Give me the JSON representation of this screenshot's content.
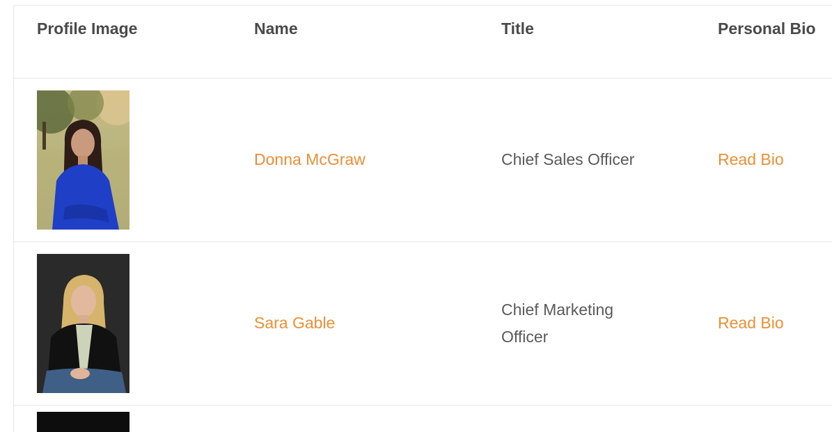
{
  "table": {
    "headers": {
      "profile_image": "Profile Image",
      "name": "Name",
      "title": "Title",
      "bio": "Personal Bio"
    },
    "rows": [
      {
        "name": "Donna McGraw",
        "title": "Chief Sales Officer",
        "bio_link": "Read Bio"
      },
      {
        "name": "Sara Gable",
        "title": "Chief Marketing Officer",
        "bio_link": "Read Bio"
      }
    ]
  },
  "colors": {
    "link": "#ef8f35",
    "header_text": "#4a4a4a",
    "body_text": "#5a5a5a",
    "border": "#e6e6e6"
  }
}
